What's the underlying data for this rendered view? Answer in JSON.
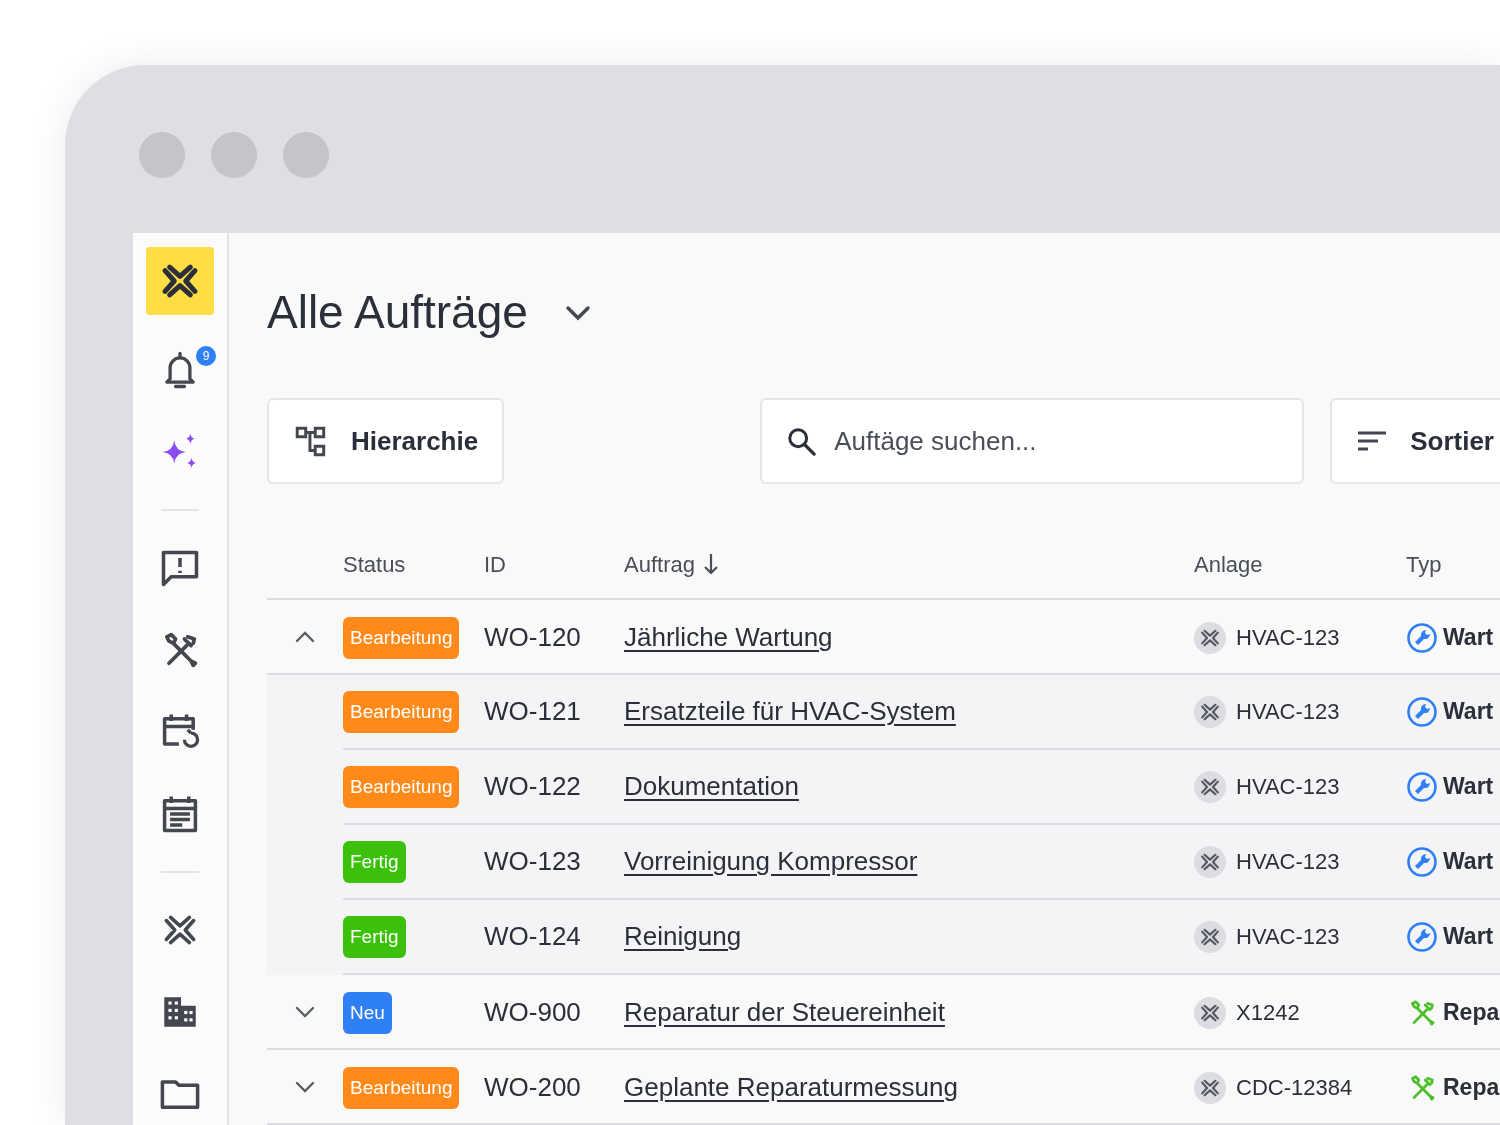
{
  "title": "Alle Aufträge",
  "sidebar": {
    "notification_badge": "9"
  },
  "toolbar": {
    "hierarchy_button": "Hierarchie",
    "search": {
      "placeholder": "Auftäge suchen..."
    },
    "sort_button": "Sortier"
  },
  "table": {
    "columns": [
      {
        "label": "Status",
        "sorted": false
      },
      {
        "label": "ID",
        "sorted": false
      },
      {
        "label": "Auftrag",
        "sorted": true
      },
      {
        "label": "Anlage",
        "sorted": false
      },
      {
        "label": "Typ",
        "sorted": false
      }
    ],
    "rows": [
      {
        "expanded": true,
        "status": {
          "label": "Bearbeitung",
          "color": "#ff8a1a"
        },
        "id": "WO-120",
        "order": "Jährliche Wartung",
        "asset": "HVAC-123",
        "type": {
          "kind": "maintenance",
          "label": "Wart"
        },
        "children": [
          {
            "status": {
              "label": "Bearbeitung",
              "color": "#ff8a1a"
            },
            "id": "WO-121",
            "order": "Ersatzteile für HVAC-System",
            "asset": "HVAC-123",
            "type": {
              "kind": "maintenance",
              "label": "Wart"
            }
          },
          {
            "status": {
              "label": "Bearbeitung",
              "color": "#ff8a1a"
            },
            "id": "WO-122",
            "order": "Dokumentation",
            "asset": "HVAC-123",
            "type": {
              "kind": "maintenance",
              "label": "Wart"
            }
          },
          {
            "status": {
              "label": "Fertig",
              "color": "#3cc10a"
            },
            "id": "WO-123",
            "order": "Vorreinigung Kompressor",
            "asset": "HVAC-123",
            "type": {
              "kind": "maintenance",
              "label": "Wart"
            }
          },
          {
            "status": {
              "label": "Fertig",
              "color": "#3cc10a"
            },
            "id": "WO-124",
            "order": "Reinigung",
            "asset": "HVAC-123",
            "type": {
              "kind": "maintenance",
              "label": "Wart"
            }
          }
        ]
      },
      {
        "expanded": false,
        "status": {
          "label": "Neu",
          "color": "#2f7ff5"
        },
        "id": "WO-900",
        "order": "Reparatur der Steuereinheit",
        "asset": "X1242",
        "type": {
          "kind": "repair",
          "label": "Repa"
        }
      },
      {
        "expanded": false,
        "status": {
          "label": "Bearbeitung",
          "color": "#ff8a1a"
        },
        "id": "WO-200",
        "order": "Geplante Reparaturmessung",
        "asset": "CDC-12384",
        "type": {
          "kind": "repair",
          "label": "Repa"
        }
      }
    ]
  }
}
